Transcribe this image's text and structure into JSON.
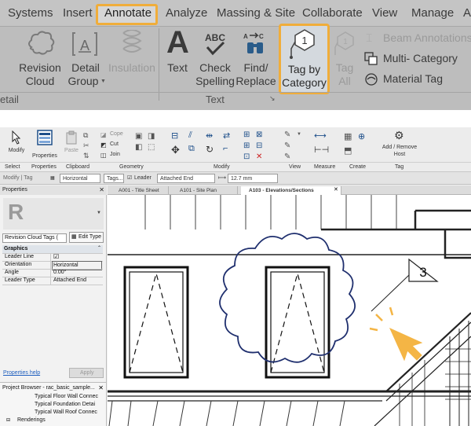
{
  "ribbon": {
    "tabs": [
      "Systems",
      "Insert",
      "Annotate",
      "Analyze",
      "Massing & Site",
      "Collaborate",
      "View",
      "Manage",
      "A"
    ],
    "buttons": {
      "revision_cloud": [
        "Revision",
        "Cloud"
      ],
      "detail_group": [
        "Detail",
        "Group"
      ],
      "insulation": "Insulation",
      "text": "Text",
      "check_spelling": [
        "Check",
        "Spelling"
      ],
      "find_replace": [
        "Find/",
        "Replace"
      ],
      "tag_by_category": [
        "Tag by",
        "Category"
      ],
      "tag_all": [
        "Tag",
        "All"
      ],
      "beam_annotations": "Beam  Annotations",
      "multi_category": "Multi- Category",
      "material_tag": "Material  Tag"
    },
    "panels": {
      "detail": "etail",
      "text": "Text"
    }
  },
  "small_ribbon": {
    "modify": "Modify",
    "properties": "Properties",
    "paste": "Paste",
    "cope": "Cope",
    "cut": "Cut",
    "join": "Join",
    "add_remove_host": [
      "Add / Remove",
      "Host"
    ],
    "panels": [
      "Select",
      "Properties",
      "Clipboard",
      "Geometry",
      "Modify",
      "View",
      "Measure",
      "Create",
      "Tag"
    ]
  },
  "options_bar": {
    "context": "Modify | Tag",
    "orientation": "Horizontal",
    "tags_button": "Tags...",
    "leader_label": "Leader",
    "leader_end": "Attached End",
    "distance": "12.7 mm"
  },
  "properties": {
    "title": "Properties",
    "type_selector": "Revision Cloud Tags (",
    "edit_type": "Edit Type",
    "section": "Graphics",
    "rows": [
      {
        "name": "Leader Line",
        "value": ""
      },
      {
        "name": "Orientation",
        "value": "Horizontal"
      },
      {
        "name": "Angle",
        "value": "0.00°"
      },
      {
        "name": "Leader Type",
        "value": "Attached End"
      }
    ],
    "help_link": "Properties help",
    "apply": "Apply"
  },
  "browser": {
    "title": "Project Browser - rac_basic_sample...",
    "items": [
      "Typical Floor Wall Connec",
      "Typical Foundation Detai",
      "Typical Wall Roof Connec",
      "Renderings"
    ]
  },
  "view_tabs": [
    "A001 - Title Sheet",
    "A101 - Site Plan",
    "A103 - Elevations/Sections"
  ],
  "canvas": {
    "tag_number": "3"
  },
  "colors": {
    "highlight": "#f0ad3a",
    "cloud": "#1f2f6e",
    "cursor": "#f4b545"
  }
}
